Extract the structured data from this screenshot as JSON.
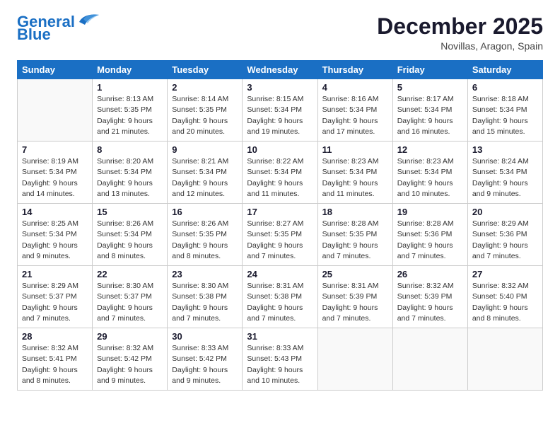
{
  "header": {
    "logo_line1": "General",
    "logo_line2": "Blue",
    "month": "December 2025",
    "location": "Novillas, Aragon, Spain"
  },
  "days_of_week": [
    "Sunday",
    "Monday",
    "Tuesday",
    "Wednesday",
    "Thursday",
    "Friday",
    "Saturday"
  ],
  "weeks": [
    [
      {
        "day": "",
        "content": ""
      },
      {
        "day": "1",
        "content": "Sunrise: 8:13 AM\nSunset: 5:35 PM\nDaylight: 9 hours\nand 21 minutes."
      },
      {
        "day": "2",
        "content": "Sunrise: 8:14 AM\nSunset: 5:35 PM\nDaylight: 9 hours\nand 20 minutes."
      },
      {
        "day": "3",
        "content": "Sunrise: 8:15 AM\nSunset: 5:34 PM\nDaylight: 9 hours\nand 19 minutes."
      },
      {
        "day": "4",
        "content": "Sunrise: 8:16 AM\nSunset: 5:34 PM\nDaylight: 9 hours\nand 17 minutes."
      },
      {
        "day": "5",
        "content": "Sunrise: 8:17 AM\nSunset: 5:34 PM\nDaylight: 9 hours\nand 16 minutes."
      },
      {
        "day": "6",
        "content": "Sunrise: 8:18 AM\nSunset: 5:34 PM\nDaylight: 9 hours\nand 15 minutes."
      }
    ],
    [
      {
        "day": "7",
        "content": "Sunrise: 8:19 AM\nSunset: 5:34 PM\nDaylight: 9 hours\nand 14 minutes."
      },
      {
        "day": "8",
        "content": "Sunrise: 8:20 AM\nSunset: 5:34 PM\nDaylight: 9 hours\nand 13 minutes."
      },
      {
        "day": "9",
        "content": "Sunrise: 8:21 AM\nSunset: 5:34 PM\nDaylight: 9 hours\nand 12 minutes."
      },
      {
        "day": "10",
        "content": "Sunrise: 8:22 AM\nSunset: 5:34 PM\nDaylight: 9 hours\nand 11 minutes."
      },
      {
        "day": "11",
        "content": "Sunrise: 8:23 AM\nSunset: 5:34 PM\nDaylight: 9 hours\nand 11 minutes."
      },
      {
        "day": "12",
        "content": "Sunrise: 8:23 AM\nSunset: 5:34 PM\nDaylight: 9 hours\nand 10 minutes."
      },
      {
        "day": "13",
        "content": "Sunrise: 8:24 AM\nSunset: 5:34 PM\nDaylight: 9 hours\nand 9 minutes."
      }
    ],
    [
      {
        "day": "14",
        "content": "Sunrise: 8:25 AM\nSunset: 5:34 PM\nDaylight: 9 hours\nand 9 minutes."
      },
      {
        "day": "15",
        "content": "Sunrise: 8:26 AM\nSunset: 5:34 PM\nDaylight: 9 hours\nand 8 minutes."
      },
      {
        "day": "16",
        "content": "Sunrise: 8:26 AM\nSunset: 5:35 PM\nDaylight: 9 hours\nand 8 minutes."
      },
      {
        "day": "17",
        "content": "Sunrise: 8:27 AM\nSunset: 5:35 PM\nDaylight: 9 hours\nand 7 minutes."
      },
      {
        "day": "18",
        "content": "Sunrise: 8:28 AM\nSunset: 5:35 PM\nDaylight: 9 hours\nand 7 minutes."
      },
      {
        "day": "19",
        "content": "Sunrise: 8:28 AM\nSunset: 5:36 PM\nDaylight: 9 hours\nand 7 minutes."
      },
      {
        "day": "20",
        "content": "Sunrise: 8:29 AM\nSunset: 5:36 PM\nDaylight: 9 hours\nand 7 minutes."
      }
    ],
    [
      {
        "day": "21",
        "content": "Sunrise: 8:29 AM\nSunset: 5:37 PM\nDaylight: 9 hours\nand 7 minutes."
      },
      {
        "day": "22",
        "content": "Sunrise: 8:30 AM\nSunset: 5:37 PM\nDaylight: 9 hours\nand 7 minutes."
      },
      {
        "day": "23",
        "content": "Sunrise: 8:30 AM\nSunset: 5:38 PM\nDaylight: 9 hours\nand 7 minutes."
      },
      {
        "day": "24",
        "content": "Sunrise: 8:31 AM\nSunset: 5:38 PM\nDaylight: 9 hours\nand 7 minutes."
      },
      {
        "day": "25",
        "content": "Sunrise: 8:31 AM\nSunset: 5:39 PM\nDaylight: 9 hours\nand 7 minutes."
      },
      {
        "day": "26",
        "content": "Sunrise: 8:32 AM\nSunset: 5:39 PM\nDaylight: 9 hours\nand 7 minutes."
      },
      {
        "day": "27",
        "content": "Sunrise: 8:32 AM\nSunset: 5:40 PM\nDaylight: 9 hours\nand 8 minutes."
      }
    ],
    [
      {
        "day": "28",
        "content": "Sunrise: 8:32 AM\nSunset: 5:41 PM\nDaylight: 9 hours\nand 8 minutes."
      },
      {
        "day": "29",
        "content": "Sunrise: 8:32 AM\nSunset: 5:42 PM\nDaylight: 9 hours\nand 9 minutes."
      },
      {
        "day": "30",
        "content": "Sunrise: 8:33 AM\nSunset: 5:42 PM\nDaylight: 9 hours\nand 9 minutes."
      },
      {
        "day": "31",
        "content": "Sunrise: 8:33 AM\nSunset: 5:43 PM\nDaylight: 9 hours\nand 10 minutes."
      },
      {
        "day": "",
        "content": ""
      },
      {
        "day": "",
        "content": ""
      },
      {
        "day": "",
        "content": ""
      }
    ]
  ]
}
